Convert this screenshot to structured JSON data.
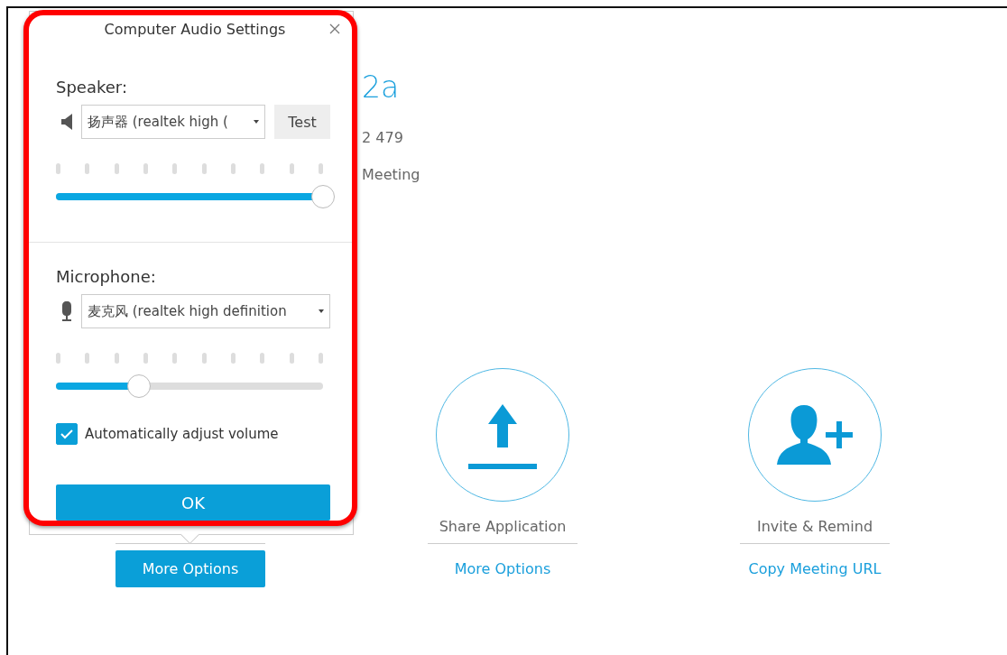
{
  "meeting": {
    "title": "2a",
    "number": "2 479",
    "end_meeting": "Meeting"
  },
  "actions": [
    {
      "kind": "audio",
      "link": "More Options",
      "selected": true
    },
    {
      "kind": "share",
      "label": "Share Application",
      "link": "More Options",
      "selected": false
    },
    {
      "kind": "invite",
      "label": "Invite & Remind",
      "link": "Copy Meeting URL",
      "selected": false
    }
  ],
  "dialog": {
    "title": "Computer Audio Settings",
    "speaker": {
      "label": "Speaker:",
      "device": "扬声器 (realtek high (",
      "test_button": "Test",
      "level": 1.0
    },
    "microphone": {
      "label": "Microphone:",
      "device": "麦克风 (realtek high definition",
      "level": 0.31
    },
    "auto_adjust": {
      "label": "Automatically adjust volume",
      "checked": true
    },
    "ok_button": "OK"
  }
}
